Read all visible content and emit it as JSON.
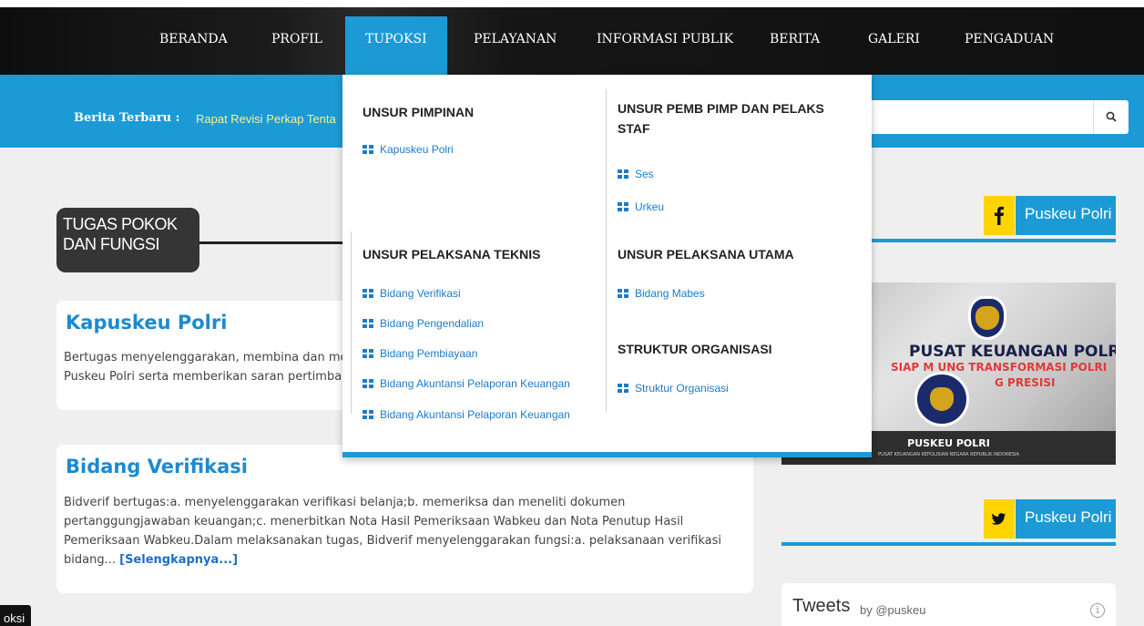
{
  "nav": {
    "items": [
      "BERANDA",
      "PROFIL",
      "TUPOKSI",
      "PELAYANAN",
      "INFORMASI PUBLIK",
      "BERITA",
      "GALERI",
      "PENGADUAN"
    ],
    "active": "TUPOKSI"
  },
  "ticker": {
    "label": "Berita Terbaru :",
    "text": "Rapat Revisi Perkap Tenta"
  },
  "search": {
    "icon": "search-icon"
  },
  "section": {
    "title": "TUGAS POKOK DAN FUNGSI"
  },
  "cards": [
    {
      "title": "Kapuskeu Polri",
      "lines": [
        "Bertugas menyelenggarakan, membina dan me",
        "Puskeu Polri serta memberikan saran pertimbar"
      ]
    },
    {
      "title": "Bidang Verifikasi",
      "lines": [
        "Bidverif bertugas:a. menyelenggarakan verifikasi belanja;b. memeriksa dan meneliti dokumen",
        "pertanggungjawaban keuangan;c. menerbitkan Nota Hasil Pemeriksaan Wabkeu dan Nota Penutup Hasil",
        "Pemeriksaan Wabkeu.Dalam melaksanakan tugas, Bidverif menyelenggarakan fungsi:a. pelaksanaan verifikasi",
        "bidang..."
      ],
      "more": "[Selengkapnya...]"
    }
  ],
  "sidebar": {
    "facebook": {
      "icon": "facebook-icon",
      "label": "Puskeu Polri"
    },
    "twitter": {
      "icon": "twitter-icon",
      "label": "Puskeu Polri"
    },
    "banner": {
      "line1": "PUSAT KEUANGAN POLRI",
      "line2": "SIAP M        UNG TRANSFORMASI POLRI",
      "line3": "G PRESISI",
      "line4": "PUSKEU POLRI",
      "line5": "PUSAT KEUANGAN KEPOLISIAN NEGARA REPUBLIK INDONESIA"
    },
    "tweets": {
      "title": "Tweets",
      "by": "by @puskeu",
      "icon": "info-icon"
    }
  },
  "corner_tab": "oksi",
  "mega": {
    "col1": [
      {
        "heading": "UNSUR PIMPINAN",
        "items": [
          "Kapuskeu Polri"
        ]
      },
      {
        "heading": "UNSUR PELAKSANA TEKNIS",
        "items": [
          "Bidang Verifikasi",
          "Bidang Pengendalian",
          "Bidang Pembiayaan",
          "Bidang Akuntansi Pelaporan Keuangan",
          "Bidang Akuntansi Pelaporan Keuangan"
        ]
      }
    ],
    "col2": [
      {
        "heading": "UNSUR PEMB PIMP DAN PELAKS STAF",
        "items": [
          "Ses",
          "Urkeu"
        ]
      },
      {
        "heading": "UNSUR PELAKSANA UTAMA",
        "items": [
          "Bidang Mabes"
        ]
      },
      {
        "heading": "STRUKTUR ORGANISASI",
        "items": [
          "Struktur Organisasi"
        ]
      }
    ]
  },
  "colors": {
    "brand_blue": "#1c9ad6",
    "link_blue": "#1c8ad0",
    "accent_yellow": "#ffd400"
  }
}
